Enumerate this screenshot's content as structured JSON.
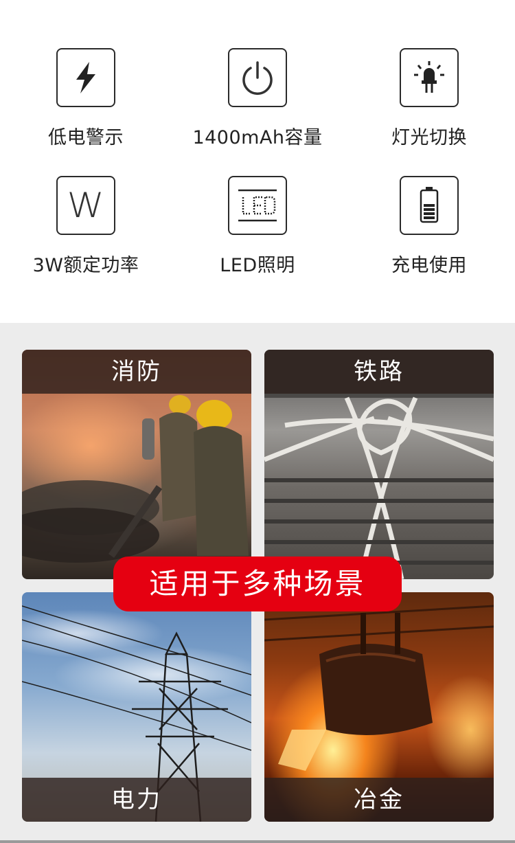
{
  "features": [
    {
      "icon": "lightning-icon",
      "label": "低电警示"
    },
    {
      "icon": "power-icon",
      "label": "1400mAh容量"
    },
    {
      "icon": "lamp-icon",
      "label": "灯光切换"
    },
    {
      "icon": "w-letter-icon",
      "icon_text": "W",
      "label": "3W额定功率"
    },
    {
      "icon": "led-icon",
      "label": "LED照明"
    },
    {
      "icon": "battery-icon",
      "label": "充电使用"
    }
  ],
  "scenes": [
    {
      "label": "消防"
    },
    {
      "label": "铁路"
    },
    {
      "label": "电力"
    },
    {
      "label": "冶金"
    }
  ],
  "banner": {
    "text": "适用于多种场景",
    "color": "#e50011"
  }
}
